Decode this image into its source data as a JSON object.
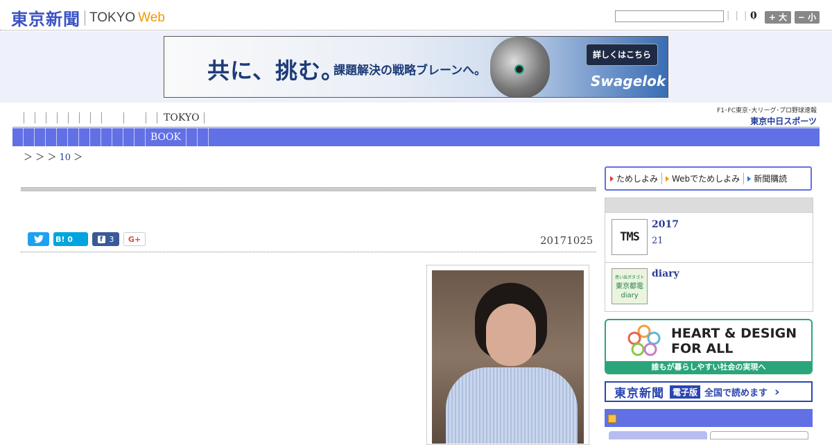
{
  "header": {
    "logo_jp": "東京新聞",
    "logo_tokyo": "TOKYO",
    "logo_web": "Web",
    "search_placeholder": "",
    "ticks": "| | | |",
    "count": "0",
    "font_large_label": "+ 大",
    "font_small_label": "− 小"
  },
  "ad": {
    "main": "共に、挑む。",
    "sub": "課題解決の戦略ブレーンへ。",
    "cta": "詳しくはこちら",
    "brand": "Swagelok"
  },
  "nav": {
    "tokyo_label": "TOKYO",
    "book_label": "BOOK",
    "sports_top": "F1･FC東京･大リーグ･プロ野球速報",
    "sports_logo": "東京中日スポーツ"
  },
  "breadcrumb": {
    "sep1": "＞",
    "sep2": "＞",
    "sep3": "＞",
    "link": "10",
    "sep4": "＞"
  },
  "article": {
    "date": "20171025",
    "share": {
      "twitter_icon": "twitter-bird",
      "hatena_label": "B! 0",
      "facebook_count": "3",
      "gplus_label": "G+"
    }
  },
  "sidebar": {
    "buttons": [
      {
        "label": "ためしよみ",
        "arrow_color": "#e03a2b"
      },
      {
        "label": "Webでためしよみ",
        "arrow_color": "#f39800"
      },
      {
        "label": "新聞購読",
        "arrow_color": "#2a6fd6"
      }
    ],
    "item1": {
      "thumb": "TMS",
      "title": "2017",
      "sub": "21"
    },
    "item2": {
      "thumb_line1": "思い出ガタゴト",
      "thumb_line2": "東京都電",
      "thumb_line3": "diary",
      "title": "diary"
    },
    "hd_banner": {
      "line1": "HEART & DESIGN",
      "line2": "FOR ALL",
      "foot": "誰もが暮らしやすい社会の実現へ"
    },
    "digital_banner": {
      "logo": "東京新聞",
      "badge": "電子版",
      "text": "全国で読めます"
    }
  },
  "colors": {
    "accent": "#6270e6",
    "logo_blue": "#3b52c4",
    "web_orange": "#f39800",
    "link": "#2a3d8f",
    "green": "#2aa57a"
  }
}
